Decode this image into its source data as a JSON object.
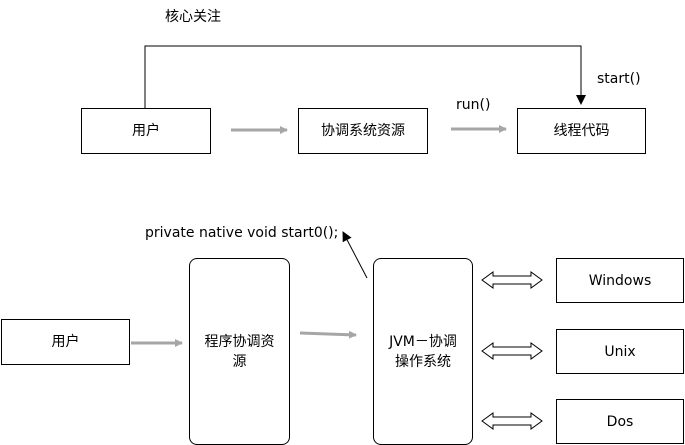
{
  "top": {
    "title": "核心关注",
    "user": "用户",
    "coord": "协调系统资源",
    "thread": "线程代码",
    "run_label": "run()",
    "start_label": "start()"
  },
  "bottom": {
    "native_label": "private native void start0();",
    "user": "用户",
    "program_line1": "程序协调资",
    "program_line2": "源",
    "jvm_line1": "JVM－协调",
    "jvm_line2": "操作系统",
    "os": [
      "Windows",
      "Unix",
      "Dos"
    ]
  },
  "colors": {
    "gray_arrow": "#a6a6a6",
    "line": "#000000"
  }
}
